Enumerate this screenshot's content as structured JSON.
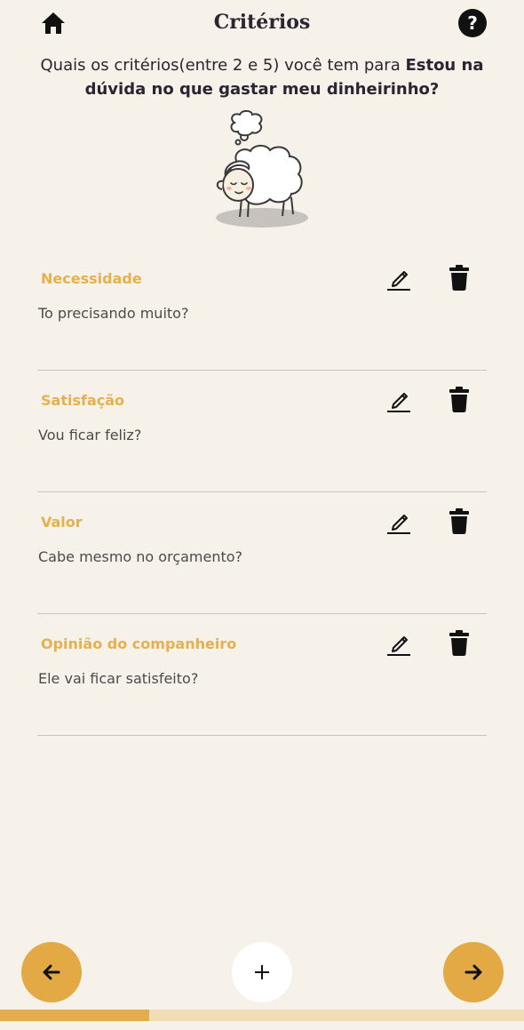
{
  "header": {
    "title": "Critérios",
    "help_label": "?"
  },
  "question": {
    "prefix": "Quais os critérios(entre 2 e 5) você tem para ",
    "subject": "Estou na dúvida no que gastar meu dinheirinho?"
  },
  "criteria": [
    {
      "name": "Necessidade",
      "description": "To precisando muito?"
    },
    {
      "name": "Satisfação",
      "description": "Vou ficar feliz?"
    },
    {
      "name": "Valor",
      "description": "Cabe mesmo no orçamento?"
    },
    {
      "name": "Opinião do companheiro",
      "description": "Ele vai ficar satisfeito?"
    }
  ],
  "icons": {
    "home": "home-icon",
    "help": "question-icon",
    "edit": "pencil-icon",
    "delete": "trash-icon",
    "back": "arrow-left-icon",
    "add": "plus-icon",
    "next": "arrow-right-icon"
  },
  "progress": {
    "fraction": 0.285
  },
  "colors": {
    "accent": "#e2a945",
    "background": "#f6f2ea",
    "label": "#e6b04c",
    "progress_track": "#f0ddb6"
  }
}
